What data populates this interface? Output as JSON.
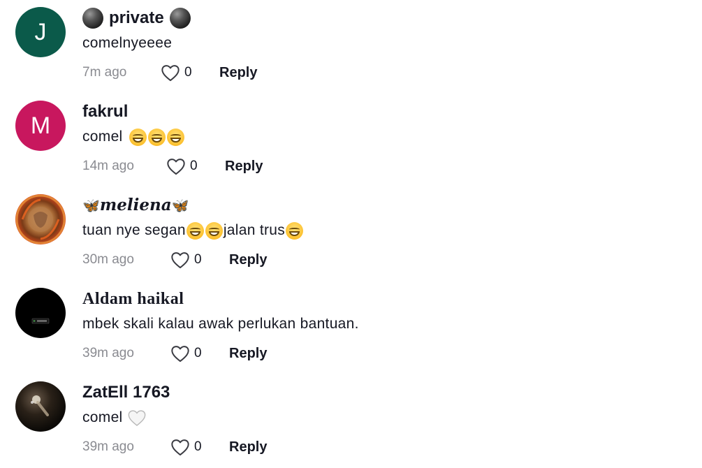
{
  "comments": [
    {
      "avatar_letter": "J",
      "avatar_color": "#0b5a4a",
      "username": "private",
      "text": "comelnyeeee",
      "time": "7m ago",
      "likes": "0",
      "reply": "Reply"
    },
    {
      "avatar_letter": "M",
      "avatar_color": "#c8175e",
      "username": "fakrul",
      "text": "comel",
      "time": "14m ago",
      "likes": "0",
      "reply": "Reply"
    },
    {
      "username": "meliena",
      "text_a": "tuan nye segan",
      "text_b": "jalan trus",
      "time": "30m ago",
      "likes": "0",
      "reply": "Reply"
    },
    {
      "username": "Aldam haikal",
      "text": "mbek skali kalau awak perlukan bantuan.",
      "time": "39m ago",
      "likes": "0",
      "reply": "Reply"
    },
    {
      "username": "ZatEll 1763",
      "text": "comel",
      "time": "39m ago",
      "likes": "0",
      "reply": "Reply"
    }
  ],
  "icons": {
    "like": "heart-outline-icon",
    "emoji_grin": "grinning-squinting-face-emoji",
    "emoji_heart": "white-heart-emoji",
    "butterfly": "butterfly-emoji",
    "ball": "black-ball-emoji"
  }
}
